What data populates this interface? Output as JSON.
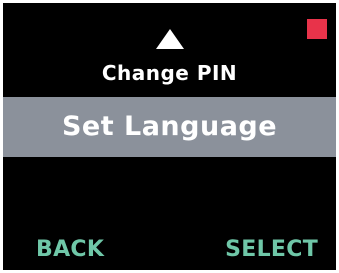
{
  "colors": {
    "screen_bg": "#000000",
    "text": "#ffffff",
    "highlight_bg": "#8b919b",
    "softkey_text": "#6fc7a8",
    "indicator": "#e8334a",
    "arrow": "#ffffff"
  },
  "icons": {
    "scroll_up": "up-triangle-icon",
    "status": "red-square-indicator-icon"
  },
  "menu": {
    "previous_item": "Change PIN",
    "selected_item": "Set Language"
  },
  "softkeys": {
    "left": "BACK",
    "right": "SELECT"
  }
}
